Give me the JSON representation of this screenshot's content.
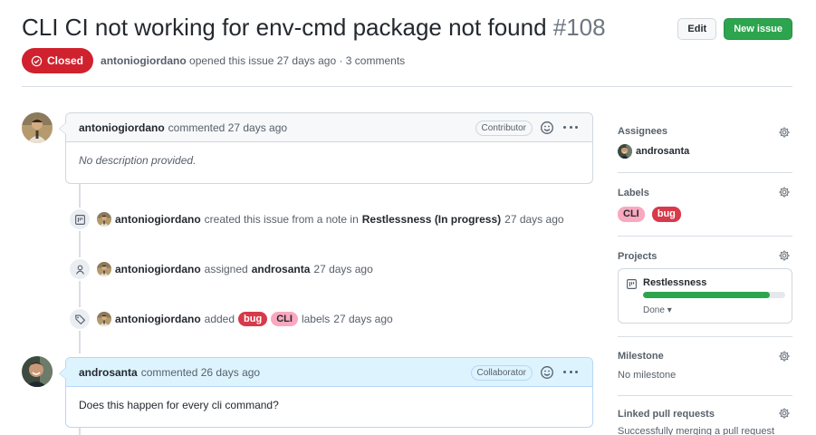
{
  "issue": {
    "title": "CLI CI not working for env-cmd package not found",
    "number": "#108",
    "state": "Closed",
    "author": "antoniogiordano",
    "opened_text": "opened this issue 27 days ago · 3 comments"
  },
  "header": {
    "edit_label": "Edit",
    "new_issue_label": "New issue"
  },
  "comments": [
    {
      "author": "antoniogiordano",
      "time": "commented 27 days ago",
      "role": "Contributor",
      "body": "No description provided."
    },
    {
      "author": "androsanta",
      "time": "commented 26 days ago",
      "role": "Collaborator",
      "body": "Does this happen for every cli command?"
    }
  ],
  "events": [
    {
      "actor": "antoniogiordano",
      "text1": "created this issue from a note in",
      "project": "Restlessness",
      "column": "(In progress)",
      "time": "27 days ago"
    },
    {
      "actor": "antoniogiordano",
      "text1": "assigned",
      "target": "androsanta",
      "time": "27 days ago"
    },
    {
      "actor": "antoniogiordano",
      "text1": "added",
      "labels": [
        "bug",
        "CLI"
      ],
      "text2": "labels",
      "time": "27 days ago"
    }
  ],
  "sidebar": {
    "assignees": {
      "title": "Assignees",
      "user": "androsanta"
    },
    "labels": {
      "title": "Labels",
      "items": [
        "CLI",
        "bug"
      ]
    },
    "projects": {
      "title": "Projects",
      "name": "Restlessness",
      "progress": 0.89,
      "status": "Done"
    },
    "milestone": {
      "title": "Milestone",
      "value": "No milestone"
    },
    "linked_prs": {
      "title": "Linked pull requests",
      "value": "Successfully merging a pull request"
    }
  },
  "colors": {
    "closed": "#cf222e",
    "green": "#2da44e",
    "bug": "#d73a4a",
    "cli": "#f9a8c0"
  }
}
